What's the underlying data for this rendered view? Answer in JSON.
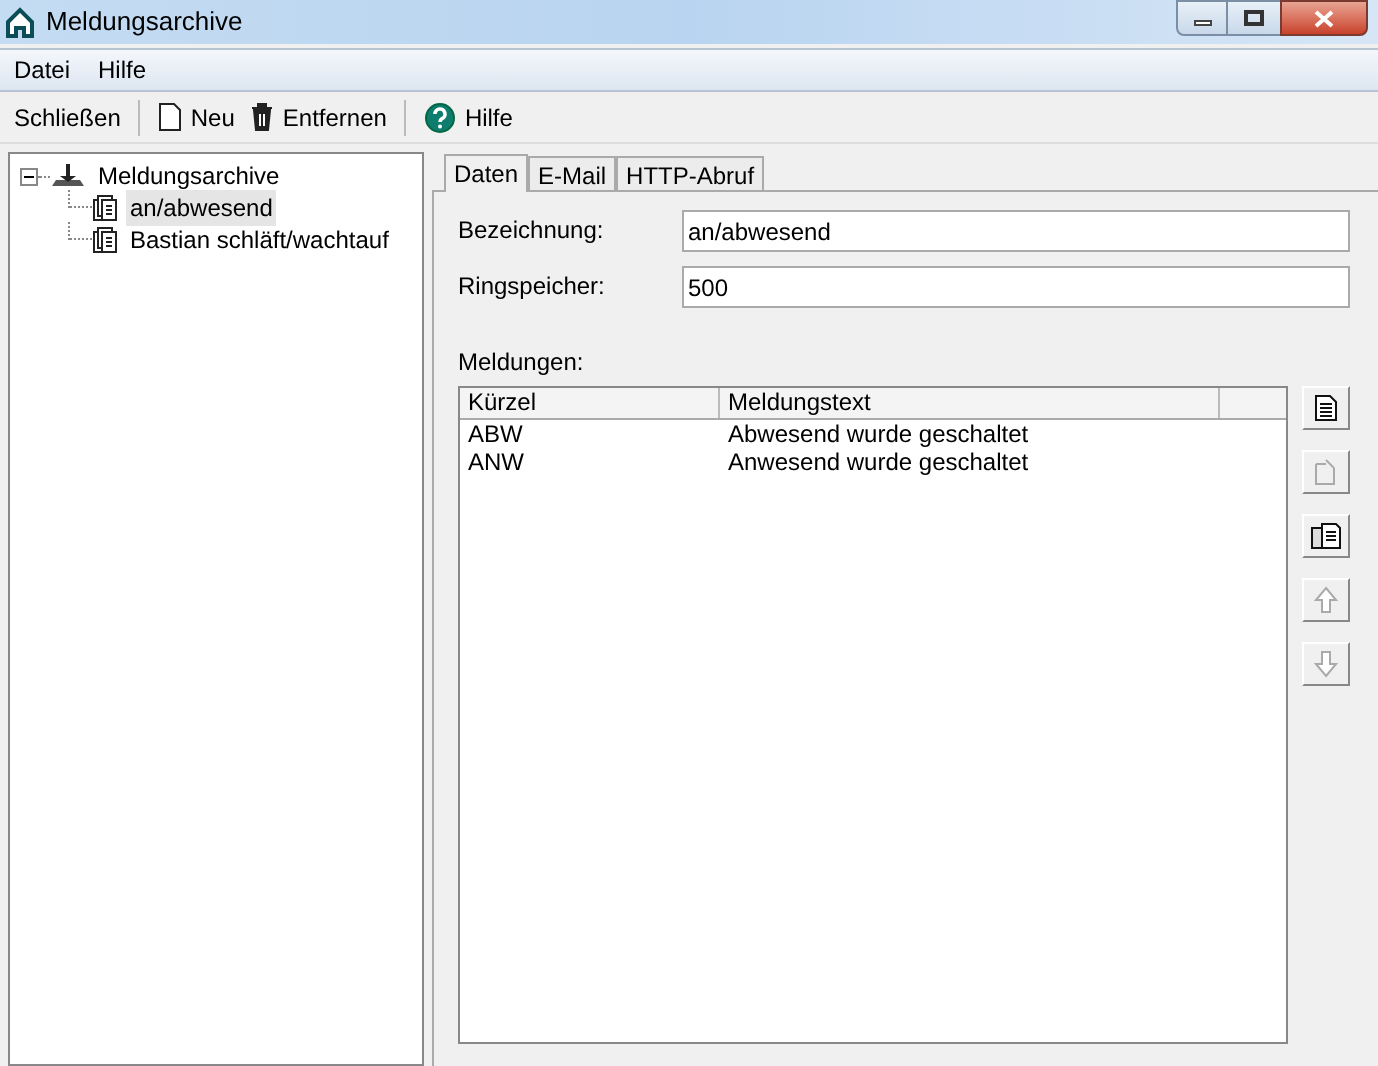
{
  "window": {
    "title": "Meldungsarchive"
  },
  "menu": [
    "Datei",
    "Hilfe"
  ],
  "toolbar": [
    {
      "kind": "text",
      "label": "Schließen"
    },
    {
      "kind": "new",
      "label": "Neu"
    },
    {
      "kind": "delete",
      "label": "Entfernen"
    },
    {
      "kind": "help",
      "label": "Hilfe"
    }
  ],
  "tree": {
    "label": "Meldungsarchive",
    "expanded": true,
    "children": [
      {
        "label": "an/abwesend",
        "selected": true
      },
      {
        "label": "Bastian schläft/wachtauf",
        "selected": false
      }
    ]
  },
  "tabs": [
    {
      "label": "Daten",
      "selected": true
    },
    {
      "label": "E-Mail",
      "selected": false
    },
    {
      "label": "HTTP-Abruf",
      "selected": false
    }
  ],
  "fields": [
    {
      "label": "Bezeichnung:",
      "value": "an/abwesend"
    },
    {
      "label": "Ringspeicher:",
      "value": "500"
    }
  ],
  "messages": {
    "label": "Meldungen:",
    "columns": [
      "Kürzel",
      "Meldungstext"
    ],
    "rows": [
      [
        "ABW",
        "Abwesend wurde geschaltet"
      ],
      [
        "ANW",
        "Anwesend wurde geschaltet"
      ]
    ]
  },
  "side_buttons": [
    {
      "kind": "new",
      "disabled": false
    },
    {
      "kind": "edit",
      "disabled": true
    },
    {
      "kind": "copy",
      "disabled": false
    },
    {
      "kind": "up",
      "disabled": true
    },
    {
      "kind": "down",
      "disabled": true
    }
  ]
}
